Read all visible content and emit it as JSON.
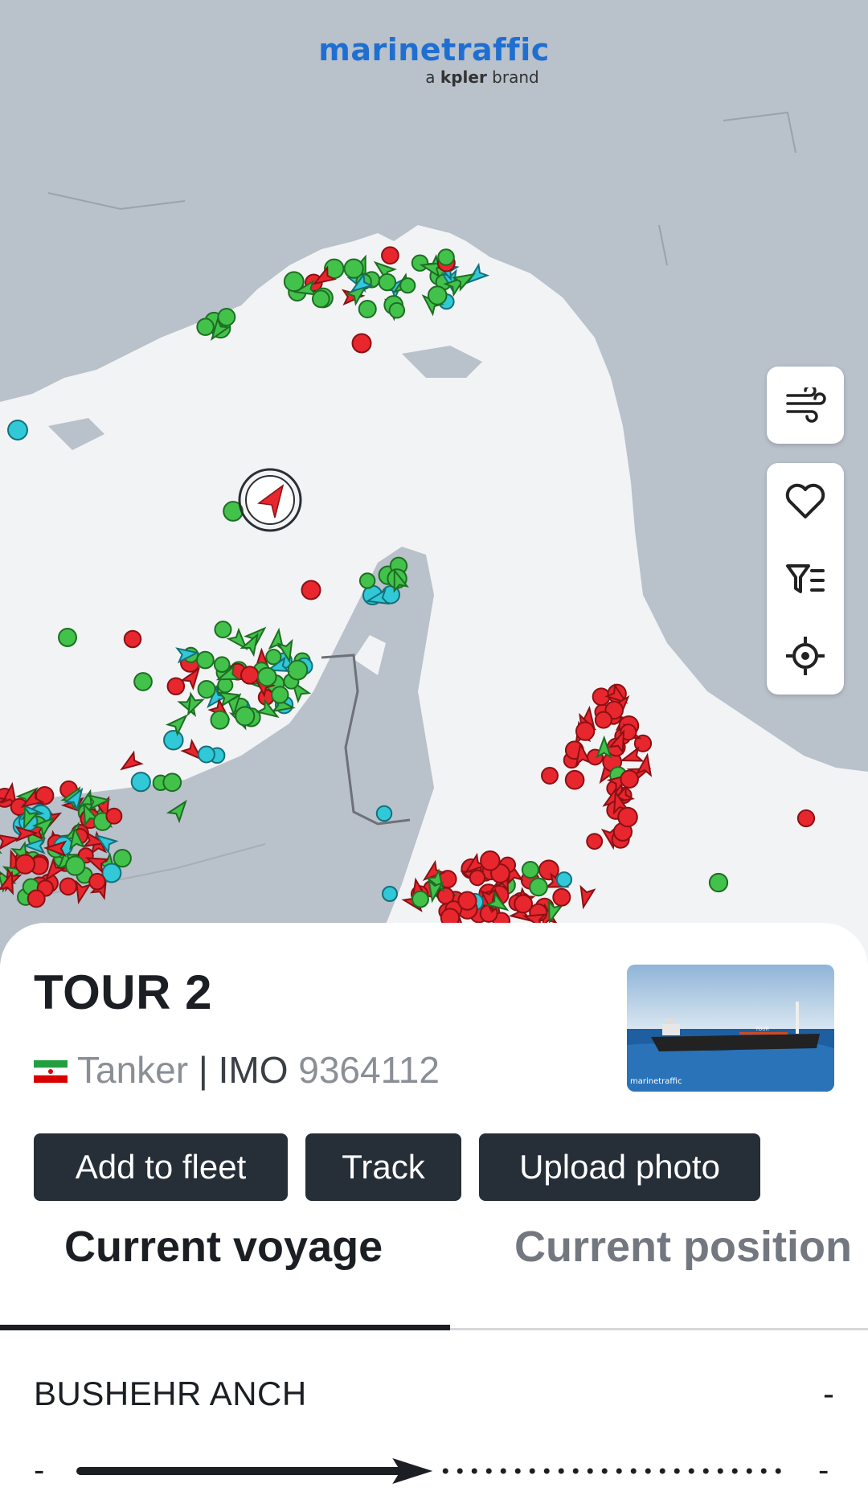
{
  "brand": {
    "name": "marinetraffic",
    "sub_prefix": "a ",
    "sub_bold": "kpler",
    "sub_suffix": " brand"
  },
  "map_controls": {
    "weather_icon": "wind-icon",
    "favorite_icon": "heart-icon",
    "filter_icon": "filter-icon",
    "locate_icon": "crosshair-icon"
  },
  "vessel": {
    "name": "TOUR 2",
    "type": "Tanker",
    "separator": "|",
    "imo_label": "IMO",
    "imo": "9364112",
    "flag": "iran-flag",
    "photo_watermark": "marinetraffic",
    "photo_ship_label": "TOUR"
  },
  "actions": {
    "add_fleet": "Add to fleet",
    "track": "Track",
    "upload_photo": "Upload photo"
  },
  "tabs": {
    "voyage": "Current voyage",
    "position": "Current position"
  },
  "voyage": {
    "departure": "BUSHEHR ANCH",
    "departure_time": "-",
    "start_label": "-",
    "end_label": "-",
    "progress": 0.45
  },
  "colors": {
    "sea": "#f2f3f5",
    "land": "#b9c1cb",
    "tanker": "#e8262e",
    "cargo": "#43c24b",
    "passenger": "#31c8d8",
    "dark_button": "#262e37",
    "brand": "#1f6fd1"
  }
}
